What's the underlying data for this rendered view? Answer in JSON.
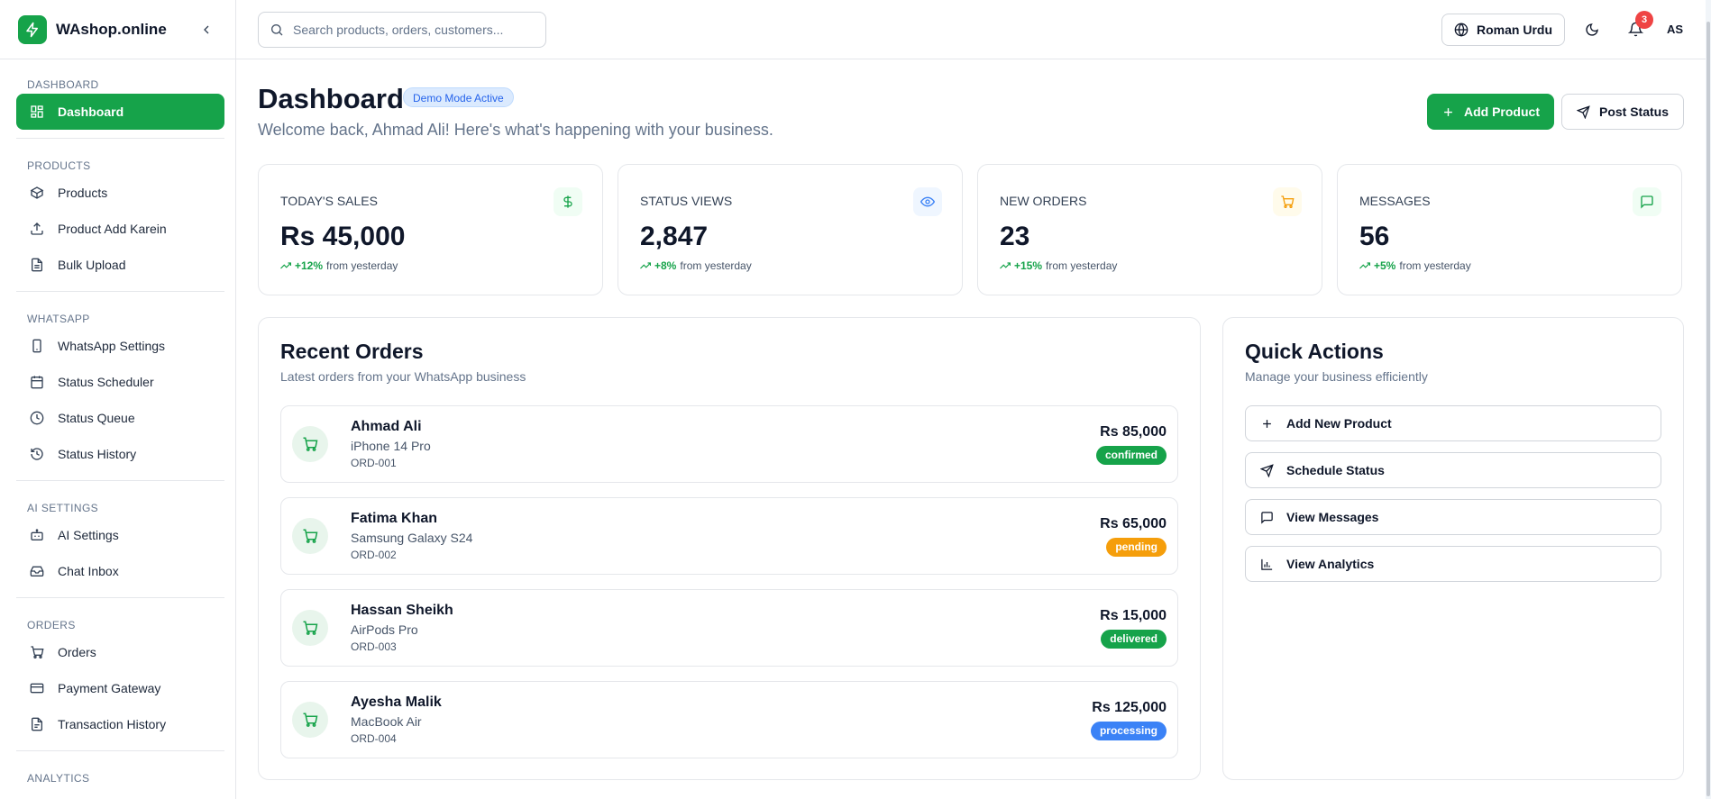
{
  "brand": {
    "name": "WAshop.online",
    "color": "#16a34a"
  },
  "sidebar": {
    "sections": [
      {
        "title": "DASHBOARD",
        "items": [
          {
            "label": "Dashboard",
            "icon": "grid-icon",
            "active": true
          }
        ]
      },
      {
        "title": "PRODUCTS",
        "items": [
          {
            "label": "Products",
            "icon": "package-icon"
          },
          {
            "label": "Product Add Karein",
            "icon": "upload-icon"
          },
          {
            "label": "Bulk Upload",
            "icon": "file-icon"
          }
        ]
      },
      {
        "title": "WHATSAPP",
        "items": [
          {
            "label": "WhatsApp Settings",
            "icon": "smartphone-icon"
          },
          {
            "label": "Status Scheduler",
            "icon": "calendar-icon"
          },
          {
            "label": "Status Queue",
            "icon": "clock-icon"
          },
          {
            "label": "Status History",
            "icon": "history-icon"
          }
        ]
      },
      {
        "title": "AI SETTINGS",
        "items": [
          {
            "label": "AI Settings",
            "icon": "bot-icon"
          },
          {
            "label": "Chat Inbox",
            "icon": "inbox-icon"
          }
        ]
      },
      {
        "title": "ORDERS",
        "items": [
          {
            "label": "Orders",
            "icon": "cart-icon"
          },
          {
            "label": "Payment Gateway",
            "icon": "credit-card-icon"
          },
          {
            "label": "Transaction History",
            "icon": "receipt-icon"
          }
        ]
      },
      {
        "title": "ANALYTICS",
        "items": []
      }
    ]
  },
  "header": {
    "search_placeholder": "Search products, orders, customers...",
    "language": "Roman Urdu",
    "notifications_count": "3",
    "avatar_initials": "AS"
  },
  "page": {
    "title": "Dashboard",
    "badge": "Demo Mode Active",
    "welcome": "Welcome back, Ahmad Ali! Here's what's happening with your business.",
    "add_product_label": "Add Product",
    "post_status_label": "Post Status"
  },
  "stats": [
    {
      "label": "TODAY'S SALES",
      "value": "Rs 45,000",
      "change": "+12%",
      "suffix": "from yesterday",
      "icon": "dollar-icon",
      "icon_color": "#16a34a",
      "icon_bg": "#f0fdf4"
    },
    {
      "label": "STATUS VIEWS",
      "value": "2,847",
      "change": "+8%",
      "suffix": "from yesterday",
      "icon": "eye-icon",
      "icon_color": "#3b82f6",
      "icon_bg": "#eff6ff"
    },
    {
      "label": "NEW ORDERS",
      "value": "23",
      "change": "+15%",
      "suffix": "from yesterday",
      "icon": "cart-icon",
      "icon_color": "#f59e0b",
      "icon_bg": "#fffbeb"
    },
    {
      "label": "MESSAGES",
      "value": "56",
      "change": "+5%",
      "suffix": "from yesterday",
      "icon": "message-icon",
      "icon_color": "#16a34a",
      "icon_bg": "#f0fdf4"
    }
  ],
  "recent_orders": {
    "title": "Recent Orders",
    "subtitle": "Latest orders from your WhatsApp business",
    "orders": [
      {
        "name": "Ahmad Ali",
        "product": "iPhone 14 Pro",
        "id": "ORD-001",
        "amount": "Rs 85,000",
        "status": "confirmed",
        "status_color": "#16a34a"
      },
      {
        "name": "Fatima Khan",
        "product": "Samsung Galaxy S24",
        "id": "ORD-002",
        "amount": "Rs 65,000",
        "status": "pending",
        "status_color": "#f59e0b"
      },
      {
        "name": "Hassan Sheikh",
        "product": "AirPods Pro",
        "id": "ORD-003",
        "amount": "Rs 15,000",
        "status": "delivered",
        "status_color": "#16a34a"
      },
      {
        "name": "Ayesha Malik",
        "product": "MacBook Air",
        "id": "ORD-004",
        "amount": "Rs 125,000",
        "status": "processing",
        "status_color": "#3b82f6"
      }
    ]
  },
  "quick_actions": {
    "title": "Quick Actions",
    "subtitle": "Manage your business efficiently",
    "items": [
      {
        "label": "Add New Product",
        "icon": "plus-icon"
      },
      {
        "label": "Schedule Status",
        "icon": "send-icon"
      },
      {
        "label": "View Messages",
        "icon": "message-icon"
      },
      {
        "label": "View Analytics",
        "icon": "bar-chart-icon"
      }
    ]
  }
}
